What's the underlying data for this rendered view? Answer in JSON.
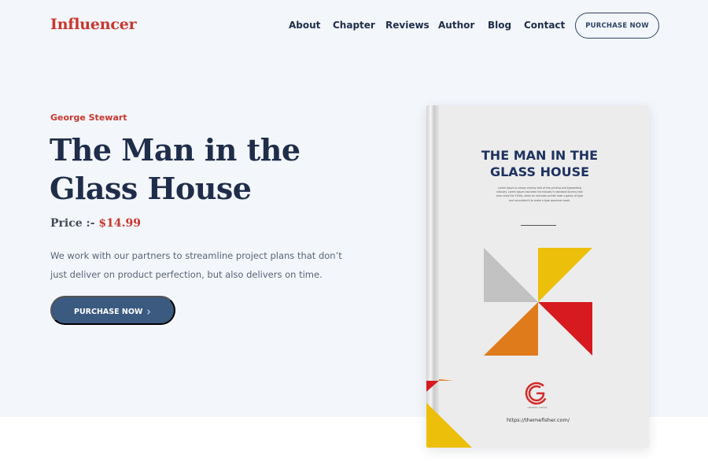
{
  "brand": {
    "logo": "Influencer"
  },
  "nav": {
    "items": [
      "About",
      "Chapter",
      "Reviews",
      "Author",
      "Blog",
      "Contact"
    ],
    "cta_label": "PURCHASE NOW"
  },
  "hero": {
    "author": "George Stewart",
    "title": "The Man in the Glass House",
    "price_label": "Price :-",
    "price_value": "$14.99",
    "description": "We work with our partners to streamline project plans that don’t just deliver on product perfection, but also delivers on time.",
    "cta_label": "PURCHASE NOW",
    "cta_icon": "chevron-right-icon"
  },
  "book": {
    "cover_title": "THE MAN IN THE GLASS HOUSE",
    "cover_blurb": "Lorem Ipsum is simply dummy text of the printing and typesetting industry. Lorem Ipsum has been the industry's standard dummy text ever since the 1500s, when an unknown printer took a galley of type and scrambled it to make a type specimen book.",
    "logo_text": "GRAPHIC CIRCLE",
    "url": "https://themefisher.com/",
    "colors": {
      "yellow": "#ecbf0a",
      "gray": "#c2c2c2",
      "orange": "#e07b1c",
      "red": "#d71920",
      "navy": "#1e3260"
    }
  },
  "colors": {
    "accent_red": "#c8372d",
    "navy": "#1f2d4a",
    "button_blue": "#3a5a80",
    "hero_bg": "#f3f6fb"
  }
}
